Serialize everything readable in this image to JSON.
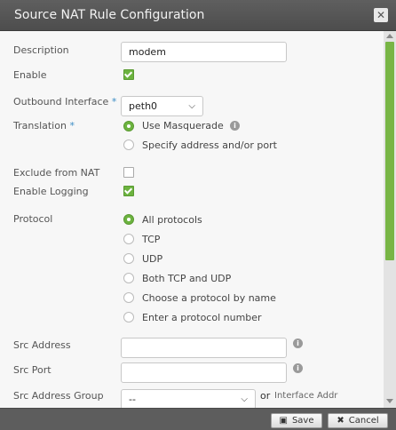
{
  "dialog": {
    "title": "Source NAT Rule Configuration",
    "close_glyph": "✕"
  },
  "form": {
    "description": {
      "label": "Description",
      "value": "modem"
    },
    "enable": {
      "label": "Enable",
      "checked": true
    },
    "outbound_interface": {
      "label": "Outbound Interface",
      "required_mark": "*",
      "value": "peth0"
    },
    "translation": {
      "label": "Translation",
      "required_mark": "*",
      "options": [
        "Use Masquerade",
        "Specify address and/or port"
      ],
      "selected": "Use Masquerade"
    },
    "exclude_from_nat": {
      "label": "Exclude from NAT",
      "checked": false
    },
    "enable_logging": {
      "label": "Enable Logging",
      "checked": true
    },
    "protocol": {
      "label": "Protocol",
      "options": [
        "All protocols",
        "TCP",
        "UDP",
        "Both TCP and UDP",
        "Choose a protocol by name",
        "Enter a protocol number"
      ],
      "selected": "All protocols"
    },
    "src_address": {
      "label": "Src Address",
      "value": ""
    },
    "src_port": {
      "label": "Src Port",
      "value": ""
    },
    "src_address_group": {
      "label": "Src Address Group",
      "value": "--",
      "or_text": "or",
      "interface_addr": "Interface Addr"
    }
  },
  "footer": {
    "save_label": "Save",
    "cancel_label": "Cancel"
  },
  "icons": {
    "info": "i",
    "chevron": "⌄",
    "save": "▣",
    "cancel": "✖"
  },
  "colors": {
    "accent_green": "#6cb33f",
    "required_blue": "#3b8dc5",
    "titlebar": "#555555"
  }
}
